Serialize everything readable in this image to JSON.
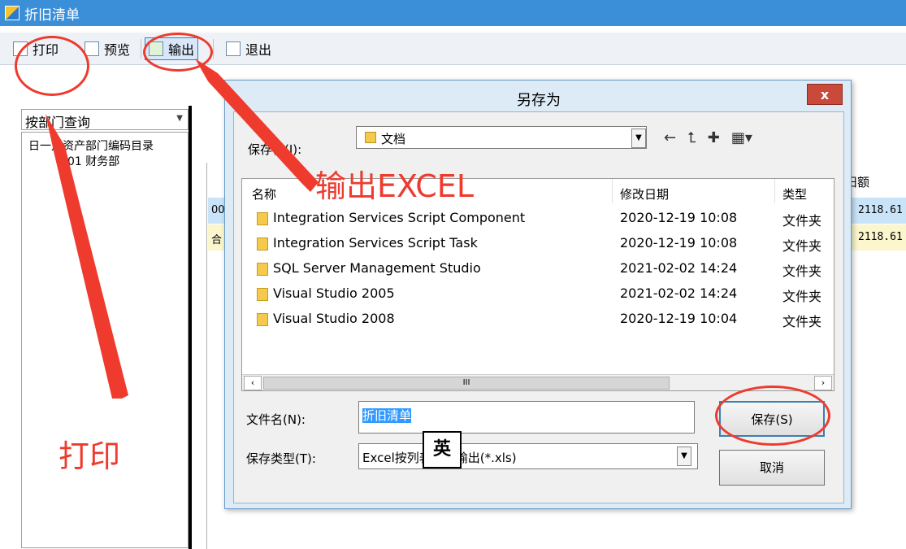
{
  "window": {
    "title": "折旧清单"
  },
  "toolbar": {
    "print": "打印",
    "preview": "预览",
    "export": "输出",
    "exit": "退出"
  },
  "left": {
    "query_mode": "按部门查询",
    "tree_root": "日一定资产部门编码目录",
    "tree_child": "01 财务部"
  },
  "grid": {
    "header_right": "旧额",
    "row1_left": "00",
    "row1_right": "2118.61",
    "row2_left": "合",
    "row2_right": "2118.61"
  },
  "dialog": {
    "title": "另存为",
    "close": "x",
    "save_in_label": "保存在(I):",
    "save_in_value": "文档",
    "columns": {
      "name": "名称",
      "modified": "修改日期",
      "type": "类型"
    },
    "files": [
      {
        "name": "Integration Services Script Component",
        "date": "2020-12-19 10:08",
        "type": "文件夹"
      },
      {
        "name": "Integration Services Script Task",
        "date": "2020-12-19 10:08",
        "type": "文件夹"
      },
      {
        "name": "SQL Server Management Studio",
        "date": "2021-02-02 14:24",
        "type": "文件夹"
      },
      {
        "name": "Visual Studio 2005",
        "date": "2021-02-02 14:24",
        "type": "文件夹"
      },
      {
        "name": "Visual Studio 2008",
        "date": "2020-12-19 10:04",
        "type": "文件夹"
      }
    ],
    "scroll_thumb": "III",
    "filename_label": "文件名(N):",
    "filename_value": "折旧清单",
    "filetype_label": "保存类型(T):",
    "filetype_value": "Excel按列表格式输出(*.xls)",
    "save_button": "保存(S)",
    "cancel_button": "取消"
  },
  "ime": "英",
  "annotations": {
    "export_excel": "输出EXCEL",
    "print": "打印"
  },
  "colors": {
    "annotation": "#ee3b2e",
    "titlebar": "#3a8fd8"
  }
}
